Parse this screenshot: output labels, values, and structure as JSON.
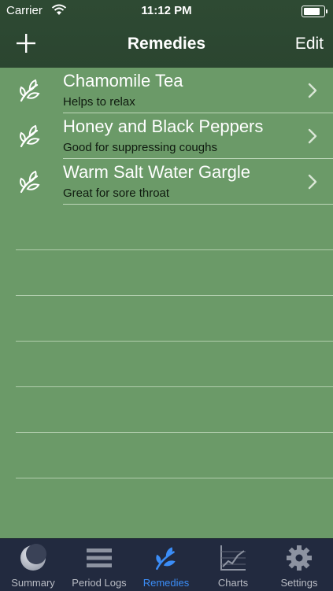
{
  "status_bar": {
    "carrier": "Carrier",
    "time": "11:12 PM",
    "battery_level": 0.9
  },
  "nav": {
    "title": "Remedies",
    "add_label": "+",
    "edit_label": "Edit"
  },
  "remedies": [
    {
      "title": "Chamomile Tea",
      "subtitle": "Helps to relax"
    },
    {
      "title": "Honey and Black Peppers",
      "subtitle": "Good for suppressing coughs"
    },
    {
      "title": "Warm Salt Water Gargle",
      "subtitle": "Great for sore throat"
    }
  ],
  "tabs": [
    {
      "label": "Summary",
      "icon": "moon-icon"
    },
    {
      "label": "Period Logs",
      "icon": "list-icon"
    },
    {
      "label": "Remedies",
      "icon": "leaf-icon",
      "active": true
    },
    {
      "label": "Charts",
      "icon": "chart-icon"
    },
    {
      "label": "Settings",
      "icon": "gear-icon"
    }
  ],
  "colors": {
    "nav_bg": "#2e4a33",
    "list_bg": "#6b9a68",
    "tab_bg": "#222a3f",
    "accent": "#3b8df7"
  }
}
